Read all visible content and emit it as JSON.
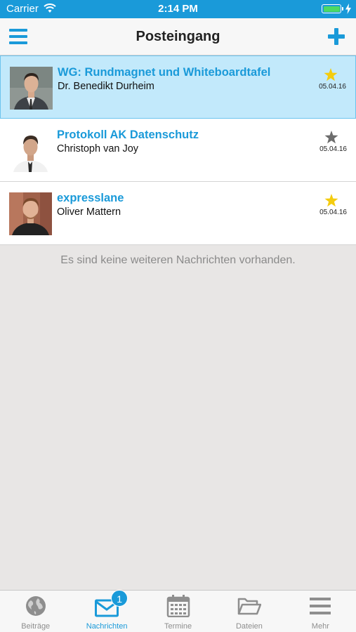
{
  "status_bar": {
    "carrier": "Carrier",
    "time": "2:14 PM",
    "battery_level": 1.0
  },
  "nav": {
    "title": "Posteingang",
    "menu_icon": "hamburger-menu-icon",
    "add_icon": "plus-icon"
  },
  "messages": [
    {
      "subject": "WG: Rundmagnet und Whiteboardtafel",
      "sender": "Dr. Benedikt Durheim",
      "date": "05.04.16",
      "starred": true,
      "selected": true
    },
    {
      "subject": "Protokoll AK Datenschutz",
      "sender": "Christoph van Joy",
      "date": "05.04.16",
      "starred": false,
      "selected": false
    },
    {
      "subject": "expresslane",
      "sender": "Oliver Mattern",
      "date": "05.04.16",
      "starred": true,
      "selected": false
    }
  ],
  "empty_note": "Es sind keine weiteren Nachrichten vorhanden.",
  "tabs": [
    {
      "label": "Beiträge",
      "icon": "globe-icon",
      "active": false
    },
    {
      "label": "Nachrichten",
      "icon": "envelope-icon",
      "active": true,
      "badge": "1"
    },
    {
      "label": "Termine",
      "icon": "calendar-icon",
      "active": false
    },
    {
      "label": "Dateien",
      "icon": "folder-icon",
      "active": false
    },
    {
      "label": "Mehr",
      "icon": "more-lines-icon",
      "active": false
    }
  ],
  "colors": {
    "accent": "#1a9ad9",
    "star_active": "#f4cc0f",
    "star_inactive": "#6d6d6d",
    "selected_row": "#c2e9fb",
    "background": "#e8e6e5"
  }
}
